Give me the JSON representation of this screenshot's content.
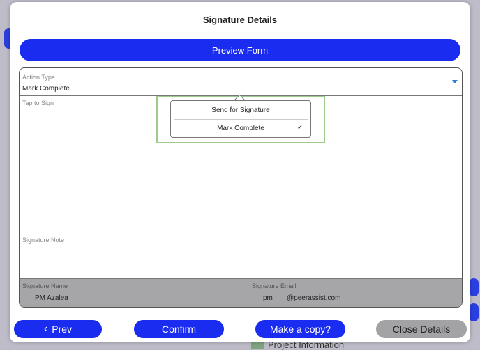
{
  "modal": {
    "title": "Signature Details",
    "preview_label": "Preview Form"
  },
  "action_type": {
    "label": "Action Type",
    "value": "Mark Complete",
    "options": [
      {
        "label": "Send for Signature",
        "selected": false
      },
      {
        "label": "Mark Complete",
        "selected": true
      }
    ]
  },
  "sign": {
    "label": "Tap to Sign"
  },
  "note": {
    "label": "Signature Note"
  },
  "signature_name": {
    "label": "Signature Name",
    "value": "PM Azalea"
  },
  "signature_email": {
    "label": "Signature Email",
    "value_user": "pm",
    "value_domain": "@peerassist.com"
  },
  "footer": {
    "prev_label": "Prev",
    "confirm_label": "Confirm",
    "copy_label": "Make a copy?",
    "close_label": "Close Details"
  },
  "background": {
    "section_label": "Project Information"
  },
  "colors": {
    "accent": "#1a2cf0",
    "highlight": "#9ccc8c",
    "grey_button": "#a3a3a5"
  }
}
